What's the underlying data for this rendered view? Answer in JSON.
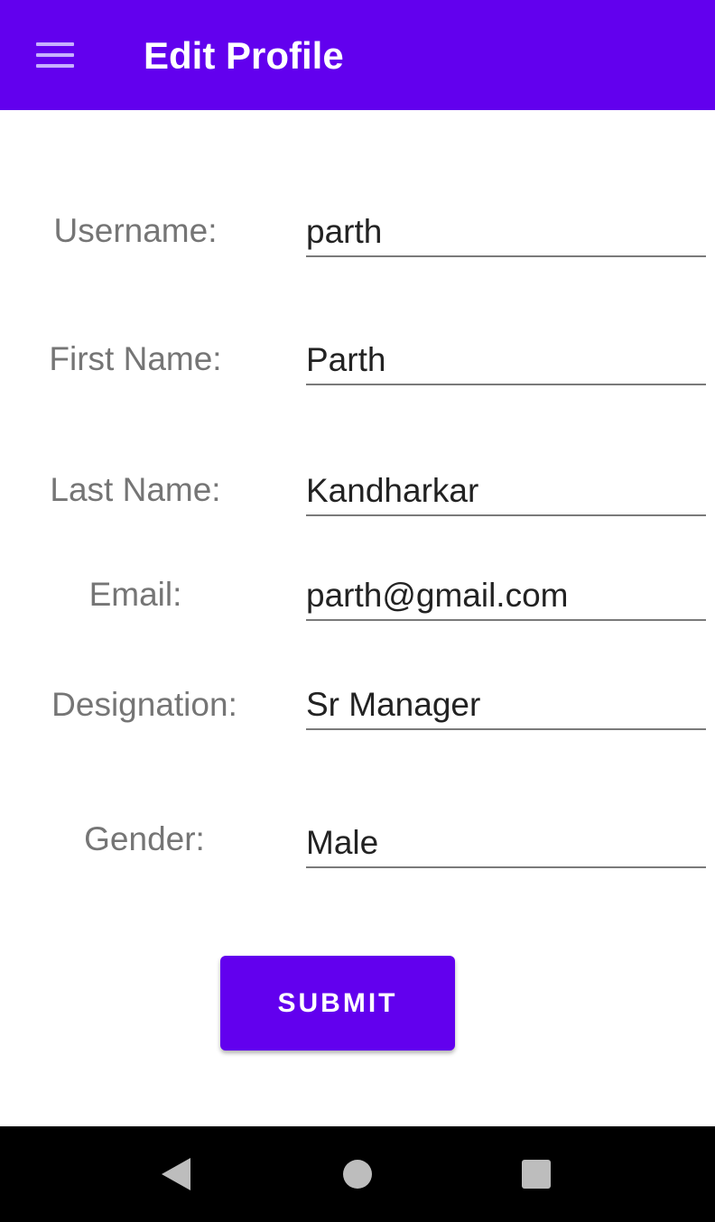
{
  "app_bar": {
    "title": "Edit Profile",
    "menu_icon": "hamburger-menu-icon",
    "background": "#6200ee"
  },
  "form": {
    "fields": [
      {
        "label": "Username:",
        "value": "parth"
      },
      {
        "label": "First Name:",
        "value": "Parth"
      },
      {
        "label": "Last Name:",
        "value": "Kandharkar"
      },
      {
        "label": "Email:",
        "value": "parth@gmail.com"
      },
      {
        "label": "Designation:",
        "value": "Sr Manager"
      },
      {
        "label": "Gender:",
        "value": "Male"
      }
    ],
    "submit_label": "SUBMIT"
  },
  "nav_bar": {
    "back_icon": "back-triangle-icon",
    "home_icon": "home-circle-icon",
    "recents_icon": "recents-square-icon"
  }
}
